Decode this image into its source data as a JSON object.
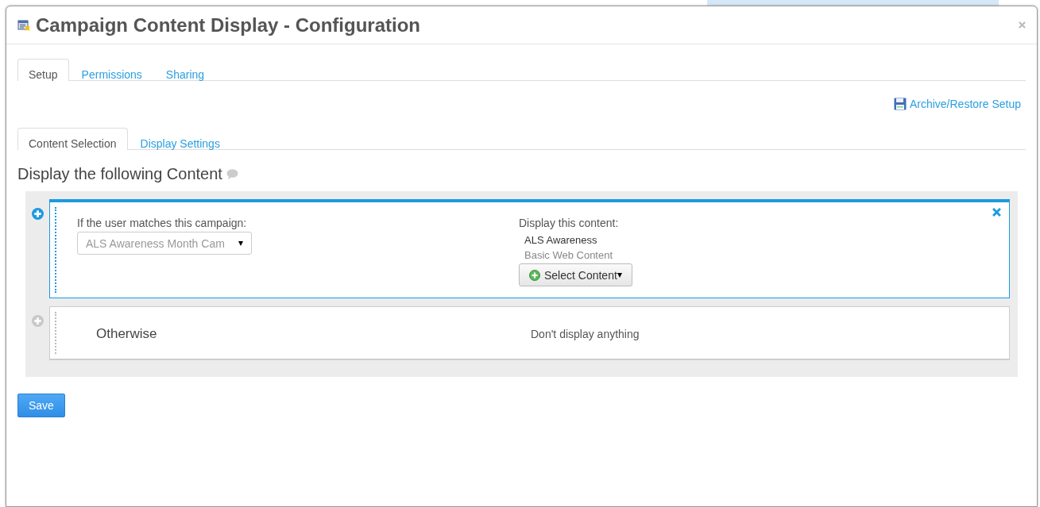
{
  "dialog": {
    "title": "Campaign Content Display - Configuration"
  },
  "tabs": [
    {
      "label": "Setup",
      "selected": true
    },
    {
      "label": "Permissions",
      "selected": false
    },
    {
      "label": "Sharing",
      "selected": false
    }
  ],
  "archive_link": "Archive/Restore Setup",
  "subtabs": [
    {
      "label": "Content Selection",
      "selected": true
    },
    {
      "label": "Display Settings",
      "selected": false
    }
  ],
  "section_title": "Display the following Content",
  "rules": [
    {
      "kind": "campaign",
      "active": true,
      "campaign_label": "If the user matches this campaign:",
      "campaign_value": "ALS Awareness Month Cam",
      "content_label": "Display this content:",
      "content_title": "ALS Awareness",
      "content_type": "Basic Web Content",
      "select_button": "Select Content"
    },
    {
      "kind": "otherwise",
      "active": false,
      "label": "Otherwise",
      "content": "Don't display anything"
    }
  ],
  "save_button": "Save"
}
